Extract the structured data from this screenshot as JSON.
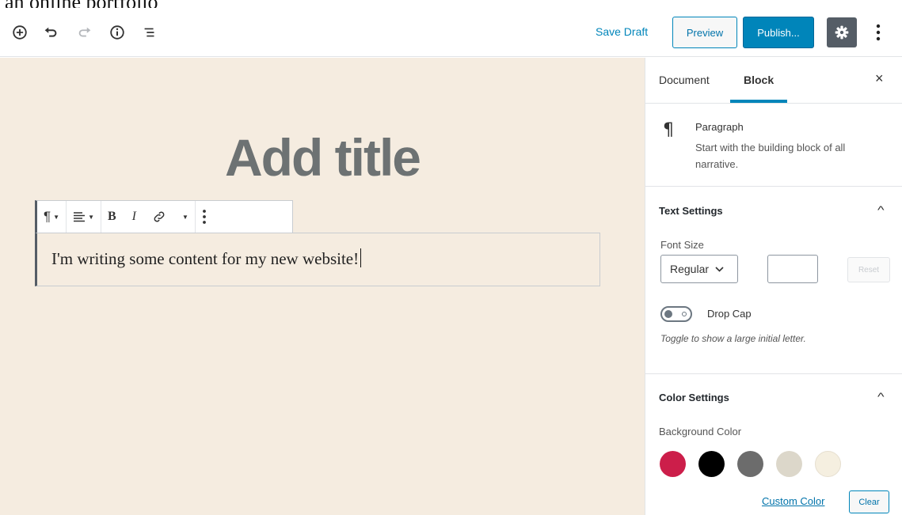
{
  "caption": "an online portfolio",
  "toolbar": {
    "icons": [
      "add-block",
      "undo",
      "redo",
      "info",
      "outline"
    ],
    "save_draft": "Save Draft",
    "preview": "Preview",
    "publish": "Publish..."
  },
  "editor": {
    "title_placeholder": "Add title",
    "paragraph_text": "I'm writing some content for my new website!",
    "block_toolbar": [
      "paragraph",
      "align-left",
      "bold",
      "italic",
      "link",
      "more-rich-text",
      "more-options"
    ],
    "background": "#f5ece0"
  },
  "sidebar": {
    "tabs": [
      {
        "label": "Document",
        "active": false
      },
      {
        "label": "Block",
        "active": true
      }
    ],
    "close": "×",
    "block_card": {
      "icon": "¶",
      "title": "Paragraph",
      "description": "Start with the building block of all narrative."
    },
    "text_settings": {
      "heading": "Text Settings",
      "font_size_label": "Font Size",
      "font_size_value": "Regular",
      "reset_label": "Reset",
      "drop_cap_label": "Drop Cap",
      "drop_cap_on": false,
      "help": "Toggle to show a large initial letter."
    },
    "color_settings": {
      "heading": "Color Settings",
      "background_label": "Background Color",
      "swatches": [
        "#cc1e4a",
        "#000000",
        "#6c6c6c",
        "#dcd7ca",
        "#f5efe0"
      ],
      "custom_color": "Custom Color",
      "clear": "Clear"
    }
  },
  "colors": {
    "accent": "#0085ba",
    "settings_button": "#555d66"
  }
}
